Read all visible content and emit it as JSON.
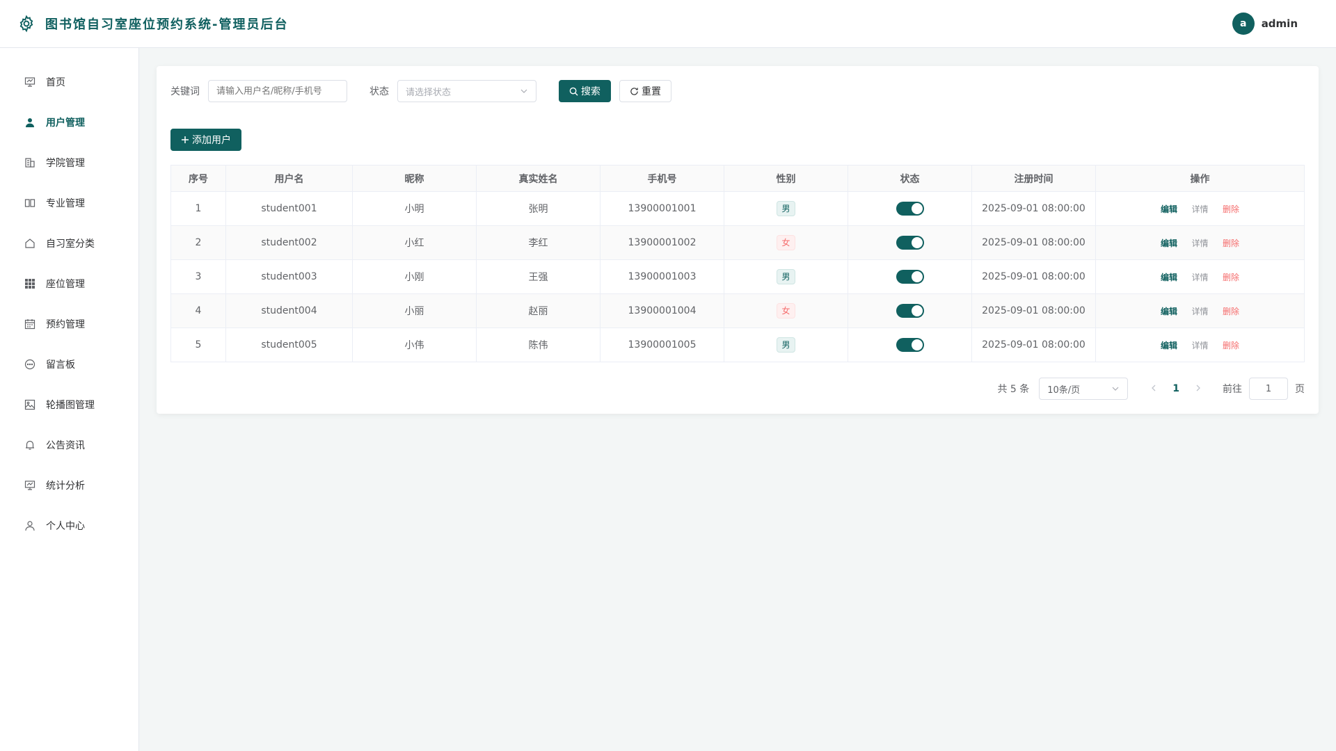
{
  "header": {
    "title": "图书馆自习室座位预约系统-管理员后台",
    "avatar_letter": "a",
    "username": "admin"
  },
  "sidebar": {
    "items": [
      {
        "label": "首页",
        "icon": "monitor-icon"
      },
      {
        "label": "用户管理",
        "icon": "user-icon"
      },
      {
        "label": "学院管理",
        "icon": "building-icon"
      },
      {
        "label": "专业管理",
        "icon": "book-icon"
      },
      {
        "label": "自习室分类",
        "icon": "house-icon"
      },
      {
        "label": "座位管理",
        "icon": "grid-icon"
      },
      {
        "label": "预约管理",
        "icon": "calendar-icon"
      },
      {
        "label": "留言板",
        "icon": "chat-icon"
      },
      {
        "label": "轮播图管理",
        "icon": "picture-icon"
      },
      {
        "label": "公告资讯",
        "icon": "bell-icon"
      },
      {
        "label": "统计分析",
        "icon": "presentation-icon"
      },
      {
        "label": "个人中心",
        "icon": "person-icon"
      }
    ],
    "active_index": 1
  },
  "search": {
    "keyword_label": "关键词",
    "keyword_placeholder": "请输入用户名/昵称/手机号",
    "status_label": "状态",
    "status_placeholder": "请选择状态",
    "search_button": "搜索",
    "reset_button": "重置"
  },
  "add_button": "添加用户",
  "table": {
    "headers": [
      "序号",
      "用户名",
      "昵称",
      "真实姓名",
      "手机号",
      "性别",
      "状态",
      "注册时间",
      "操作"
    ],
    "rows": [
      {
        "no": "1",
        "username": "student001",
        "nickname": "小明",
        "realname": "张明",
        "phone": "13900001001",
        "gender": "男",
        "status_on": true,
        "registered": "2025-09-01 08:00:00"
      },
      {
        "no": "2",
        "username": "student002",
        "nickname": "小红",
        "realname": "李红",
        "phone": "13900001002",
        "gender": "女",
        "status_on": true,
        "registered": "2025-09-01 08:00:00"
      },
      {
        "no": "3",
        "username": "student003",
        "nickname": "小刚",
        "realname": "王强",
        "phone": "13900001003",
        "gender": "男",
        "status_on": true,
        "registered": "2025-09-01 08:00:00"
      },
      {
        "no": "4",
        "username": "student004",
        "nickname": "小丽",
        "realname": "赵丽",
        "phone": "13900001004",
        "gender": "女",
        "status_on": true,
        "registered": "2025-09-01 08:00:00"
      },
      {
        "no": "5",
        "username": "student005",
        "nickname": "小伟",
        "realname": "陈伟",
        "phone": "13900001005",
        "gender": "男",
        "status_on": true,
        "registered": "2025-09-01 08:00:00"
      }
    ],
    "ops": {
      "edit": "编辑",
      "detail": "详情",
      "delete": "删除"
    }
  },
  "pagination": {
    "total_text": "共 5 条",
    "page_size": "10条/页",
    "current_page": "1",
    "goto_label": "前往",
    "goto_value": "1",
    "page_suffix": "页"
  },
  "colors": {
    "accent": "#10605f",
    "danger": "#f56c6c"
  }
}
